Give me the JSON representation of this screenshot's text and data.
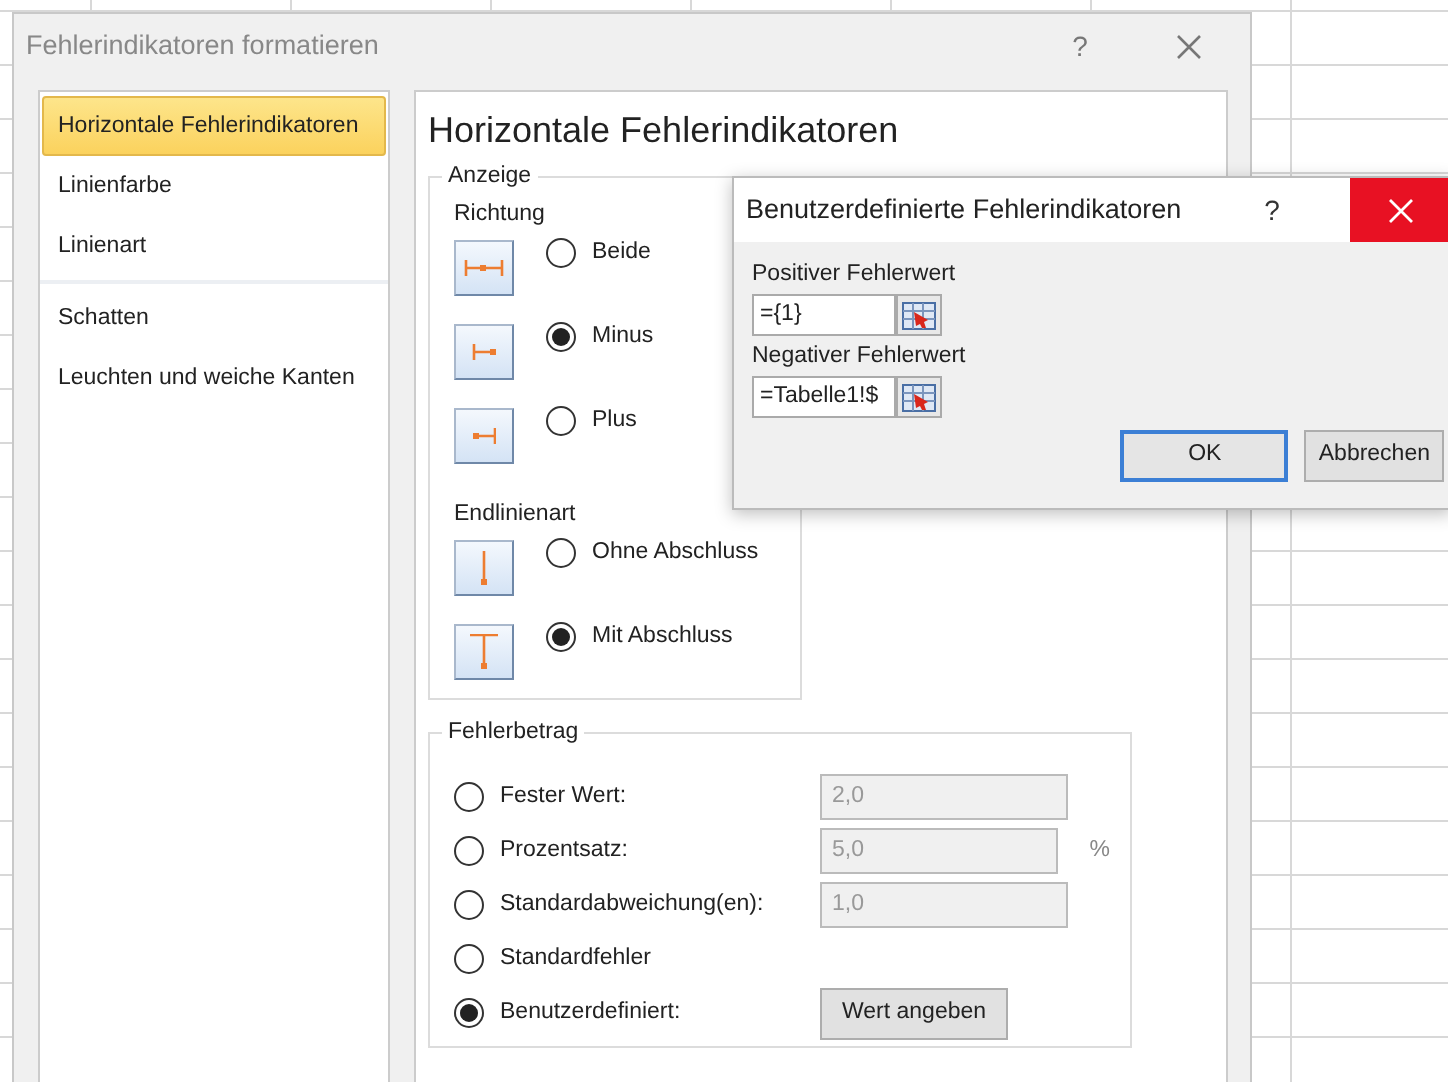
{
  "main_dialog": {
    "title": "Fehlerindikatoren formatieren",
    "help": "?",
    "sidebar": {
      "groups": [
        [
          {
            "label": "Horizontale Fehlerindikatoren",
            "selected": true
          },
          {
            "label": "Linienfarbe",
            "selected": false
          },
          {
            "label": "Linienart",
            "selected": false
          }
        ],
        [
          {
            "label": "Schatten",
            "selected": false
          },
          {
            "label": "Leuchten und weiche Kanten",
            "selected": false
          }
        ]
      ]
    },
    "panel": {
      "heading": "Horizontale Fehlerindikatoren",
      "display": {
        "title": "Anzeige",
        "sections": [
          {
            "title": "Richtung",
            "options": [
              {
                "label": "Beide",
                "kind": "both",
                "selected": false
              },
              {
                "label": "Minus",
                "kind": "minus",
                "selected": true
              },
              {
                "label": "Plus",
                "kind": "plus",
                "selected": false
              }
            ]
          },
          {
            "title": "Endlinienart",
            "options": [
              {
                "label": "Ohne Abschluss",
                "kind": "nocap",
                "selected": false
              },
              {
                "label": "Mit Abschluss",
                "kind": "cap",
                "selected": true
              }
            ]
          }
        ]
      },
      "amount": {
        "title": "Fehlerbetrag",
        "options": [
          {
            "label": "Fester Wert:",
            "selected": false,
            "field": {
              "value": "2,0",
              "disabled": true
            }
          },
          {
            "label": "Prozentsatz:",
            "selected": false,
            "field": {
              "value": "5,0",
              "disabled": true
            },
            "unit": "%"
          },
          {
            "label": "Standardabweichung(en):",
            "selected": false,
            "field": {
              "value": "1,0",
              "disabled": true
            }
          },
          {
            "label": "Standardfehler",
            "selected": false
          },
          {
            "label": "Benutzerdefiniert:",
            "selected": true,
            "button": "Wert angeben"
          }
        ]
      }
    }
  },
  "custom_dialog": {
    "title": "Benutzerdefinierte Fehlerindikatoren",
    "help": "?",
    "fields": [
      {
        "label": "Positiver Fehlerwert",
        "value": "={1}"
      },
      {
        "label": "Negativer Fehlerwert",
        "value": "=Tabelle1!$"
      }
    ],
    "buttons": [
      {
        "label": "OK",
        "default": true
      },
      {
        "label": "Abbrechen",
        "default": false
      }
    ]
  }
}
